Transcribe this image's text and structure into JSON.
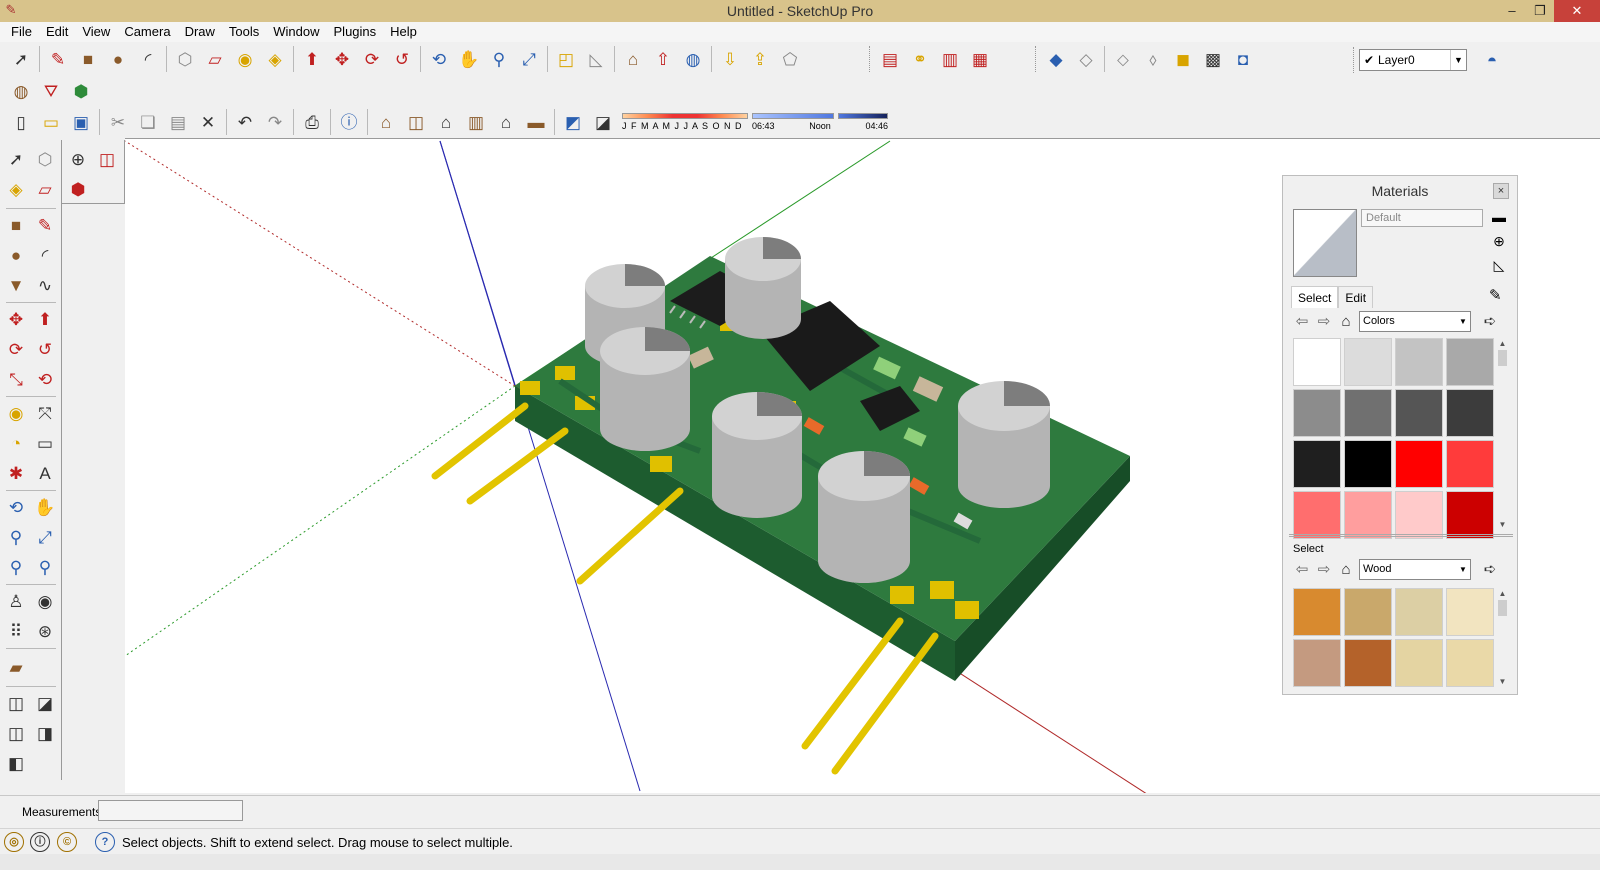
{
  "window": {
    "title": "Untitled - SketchUp Pro",
    "minimize": "–",
    "restore": "❐",
    "close": "✕"
  },
  "menu": [
    "File",
    "Edit",
    "View",
    "Camera",
    "Draw",
    "Tools",
    "Window",
    "Plugins",
    "Help"
  ],
  "layers": {
    "current": "Layer0"
  },
  "shadows": {
    "months": "J F M A M J J A S O N D",
    "time_start": "06:43",
    "time_mid": "Noon",
    "time_end": "04:46"
  },
  "materials": {
    "title": "Materials",
    "close": "×",
    "name": "Default",
    "tabs": [
      "Select",
      "Edit"
    ],
    "collection1": "Colors",
    "select_label": "Select",
    "collection2": "Wood",
    "color_swatches": [
      "#ffffff",
      "#dcdcdc",
      "#c3c3c3",
      "#a9a9a9",
      "#8c8c8c",
      "#707070",
      "#555555",
      "#3c3c3c",
      "#1f1f1f",
      "#000000",
      "#ff0000",
      "#ff3b3b",
      "#ff6e6e",
      "#ff9e9e",
      "#ffcaca",
      "#cc0000"
    ],
    "wood_swatches": [
      "#d88a2f",
      "#c9a86b",
      "#dccfa4",
      "#f2e4c0",
      "#c49a80",
      "#b4622a",
      "#e4d4a2",
      "#ead9a8"
    ]
  },
  "measurements": {
    "label": "Measurements",
    "value": ""
  },
  "status": {
    "text": "Select objects. Shift to extend select. Drag mouse to select multiple.",
    "help": "?"
  }
}
